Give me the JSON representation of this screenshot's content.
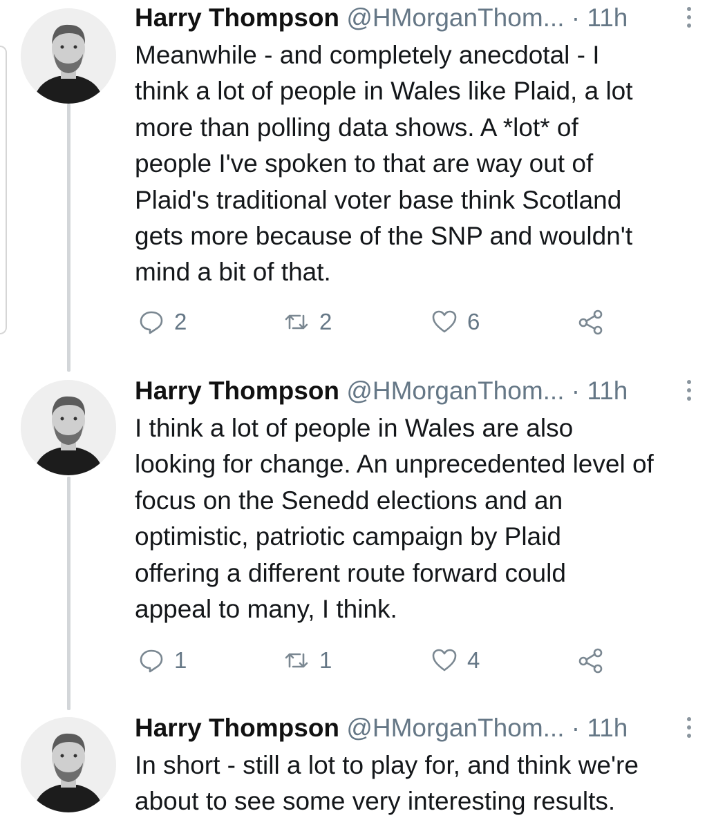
{
  "tweets": [
    {
      "author": "Harry Thompson",
      "handle": "@HMorganThom...",
      "separator": "·",
      "time": "11h",
      "lines": [
        "Meanwhile - and completely anecdotal - I",
        "think a lot of people in Wales like Plaid, a lot",
        "more than polling data shows. A *lot* of",
        "people I've spoken to that are way out of",
        "Plaid's traditional voter base think Scotland",
        "gets more because of the SNP and wouldn't",
        "mind a bit of that."
      ],
      "replies": "2",
      "retweets": "2",
      "likes": "6"
    },
    {
      "author": "Harry Thompson",
      "handle": "@HMorganThom...",
      "separator": "·",
      "time": "11h",
      "lines": [
        "I think a lot of people in Wales are also",
        "looking for change. An unprecedented level of",
        "focus on the Senedd elections and an",
        "optimistic, patriotic campaign by Plaid",
        "offering a different route forward could",
        "appeal to many, I think."
      ],
      "replies": "1",
      "retweets": "1",
      "likes": "4"
    },
    {
      "author": "Harry Thompson",
      "handle": "@HMorganThom...",
      "separator": "·",
      "time": "11h",
      "lines": [
        "In short - still a lot to play for, and think we're",
        "about to see some very interesting results."
      ]
    }
  ],
  "icons": {
    "reply": "reply-icon",
    "retweet": "retweet-icon",
    "like": "heart-icon",
    "share": "share-icon",
    "more": "more-vertical-icon"
  },
  "colors": {
    "text": "#14171a",
    "muted": "#657786",
    "thread_line": "#d3d6d9"
  }
}
